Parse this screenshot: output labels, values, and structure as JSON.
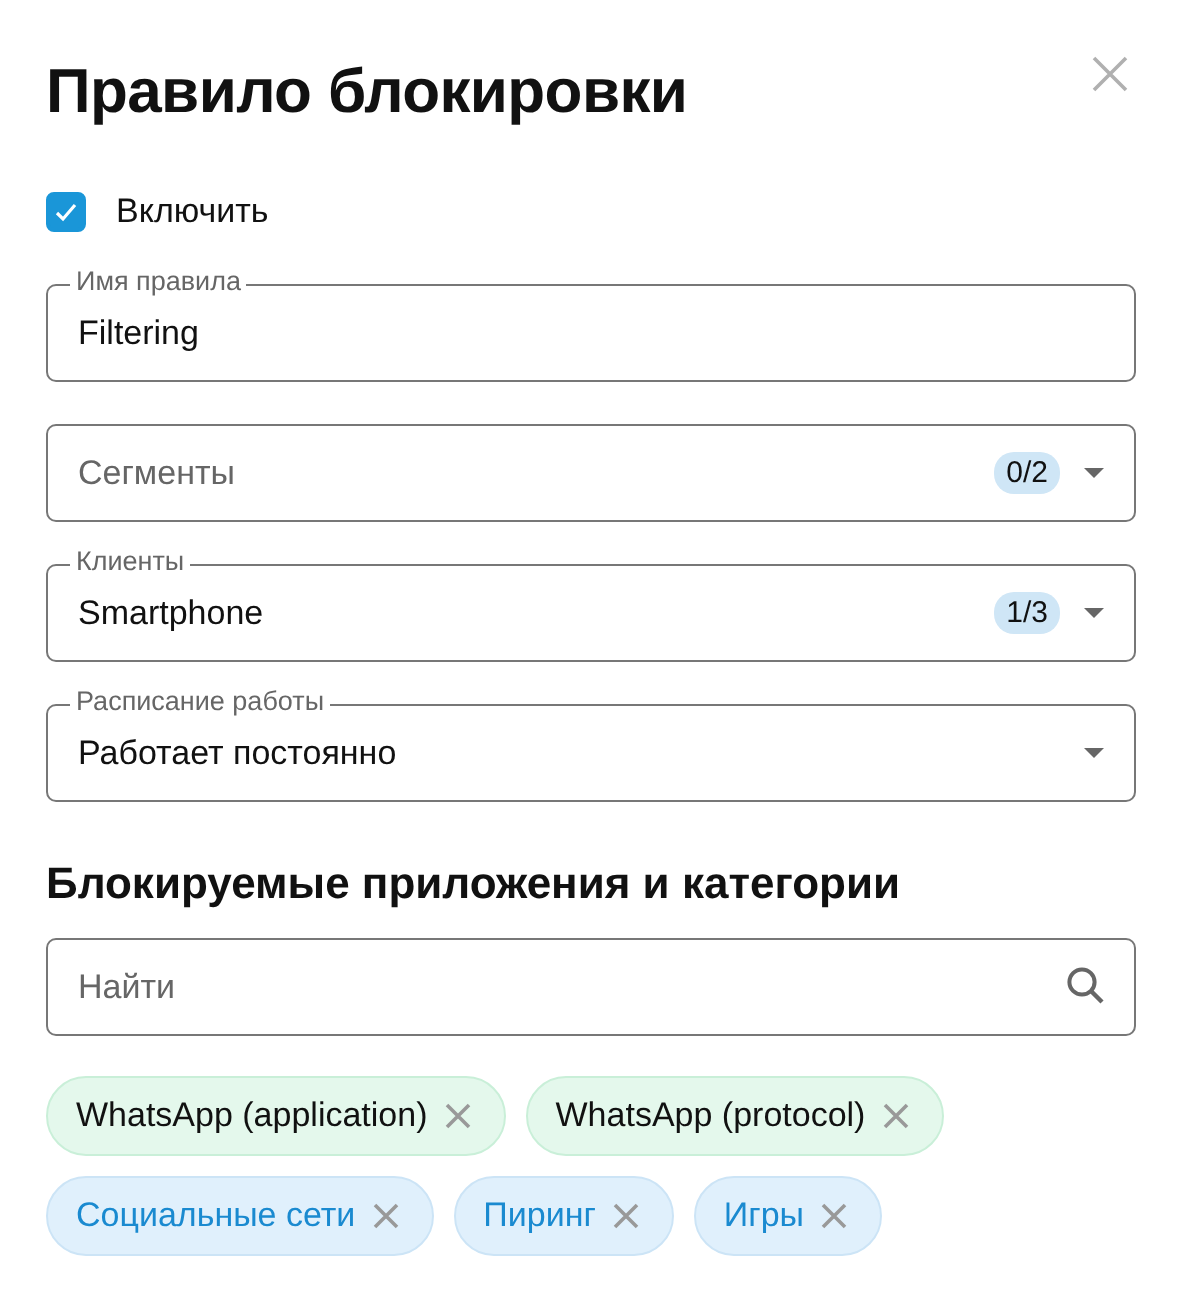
{
  "dialog": {
    "title": "Правило блокировки"
  },
  "enable": {
    "label": "Включить",
    "checked": true
  },
  "fields": [
    {
      "kind": "text",
      "label": "Имя правила",
      "value": "Filtering"
    },
    {
      "kind": "select",
      "placeholder": "Сегменты",
      "count": "0/2"
    },
    {
      "kind": "select",
      "label": "Клиенты",
      "value": "Smartphone",
      "count": "1/3"
    },
    {
      "kind": "select",
      "label": "Расписание работы",
      "value": "Работает постоянно"
    }
  ],
  "section": {
    "title": "Блокируемые приложения и категории"
  },
  "search": {
    "placeholder": "Найти"
  },
  "tags": [
    {
      "kind": "application",
      "label": "WhatsApp (application)"
    },
    {
      "kind": "application",
      "label": "WhatsApp (protocol)"
    },
    {
      "kind": "category",
      "label": "Социальные сети"
    },
    {
      "kind": "category",
      "label": "Пиринг"
    },
    {
      "kind": "category",
      "label": "Игры"
    }
  ]
}
